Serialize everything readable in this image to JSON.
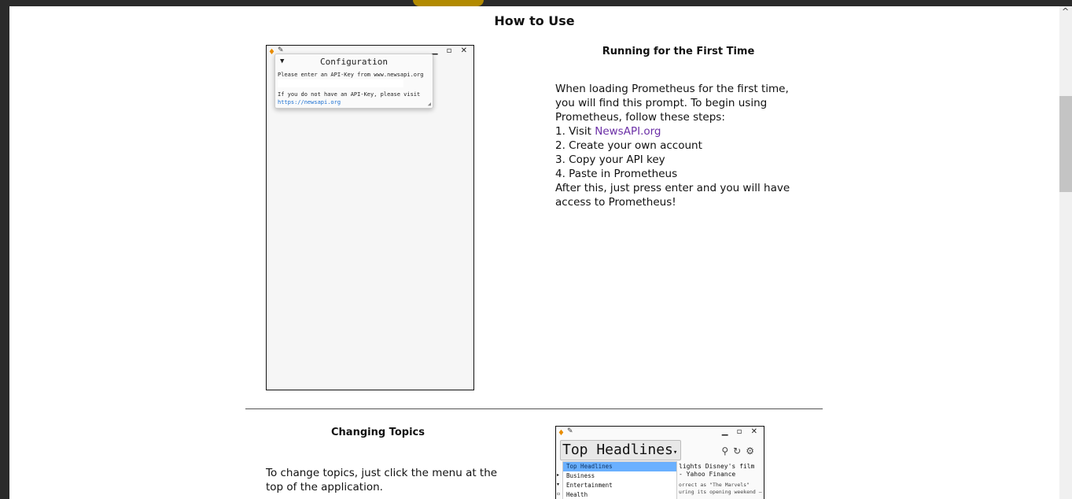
{
  "page": {
    "heading": "How to Use"
  },
  "section1": {
    "title": "Running for the First Time",
    "text": {
      "l1": "When loading Prometheus for the first time,",
      "l2": "you will find this prompt.  To begin using",
      "l3": "Prometheus, follow these steps:",
      "l4_prefix": "1. Visit ",
      "l4_link": "NewsAPI.org",
      "l5": "2. Create your own account",
      "l6": "3. Copy your API key",
      "l7": "4. Paste in Prometheus",
      "l8": "After this, just press enter and you will have",
      "l9": "access to Prometheus!"
    },
    "window": {
      "controls": "▁ ▫ ✕",
      "dialog": {
        "title": "Configuration",
        "prompt": "Please enter an API-Key from www.newsapi.org",
        "no_key": "If you do not have an API-Key, please visit",
        "link": "https://newsapi.org"
      }
    }
  },
  "section2": {
    "title": "Changing Topics",
    "text": {
      "l1": "To change topics, just click the menu at the",
      "l2": "top of the application."
    },
    "window": {
      "controls": "▁ ▫ ✕",
      "topic_selected": "Top Headlines",
      "menu": [
        "Top Headlines",
        "Business",
        "Entertainment",
        "Health"
      ],
      "headline_l1": "lights Disney's film",
      "headline_l2": "- Yahoo Finance",
      "snippet_l1": "orrect as \"The Marvels\"",
      "snippet_l2": "uring its opening weekend —"
    }
  },
  "colors": {
    "link": "#6b2fa6",
    "menu_selected": "#6ab0ff",
    "accent_icon": "#e88c00"
  }
}
